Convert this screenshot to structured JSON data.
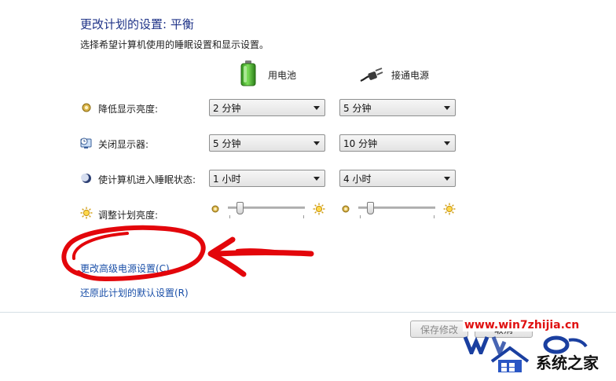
{
  "header": {
    "title": "更改计划的设置: 平衡",
    "subtitle": "选择希望计算机使用的睡眠设置和显示设置。"
  },
  "columns": {
    "battery_label": "用电池",
    "plugged_label": "接通电源"
  },
  "rows": [
    {
      "label": "降低显示亮度:",
      "battery": "2 分钟",
      "plugged": "5 分钟"
    },
    {
      "label": "关闭显示器:",
      "battery": "5 分钟",
      "plugged": "10 分钟"
    },
    {
      "label": "使计算机进入睡眠状态:",
      "battery": "1 小时",
      "plugged": "4 小时"
    }
  ],
  "brightness": {
    "label": "调整计划亮度:",
    "battery_level": 0.12,
    "plugged_level": 0.12
  },
  "links": {
    "advanced": "更改高级电源设置(C)",
    "restore": "还原此计划的默认设置(R)"
  },
  "footer": {
    "save_label": "保存修改",
    "cancel_label": "取消"
  },
  "watermark": {
    "url": "www.win7zhijia.cn",
    "brand": "系统之家"
  },
  "colors": {
    "title": "#1e3287",
    "link": "#1a4fa8",
    "annotation": "#e3060b",
    "watermark_red": "#e01010",
    "watermark_blue": "#1a3fa0"
  }
}
